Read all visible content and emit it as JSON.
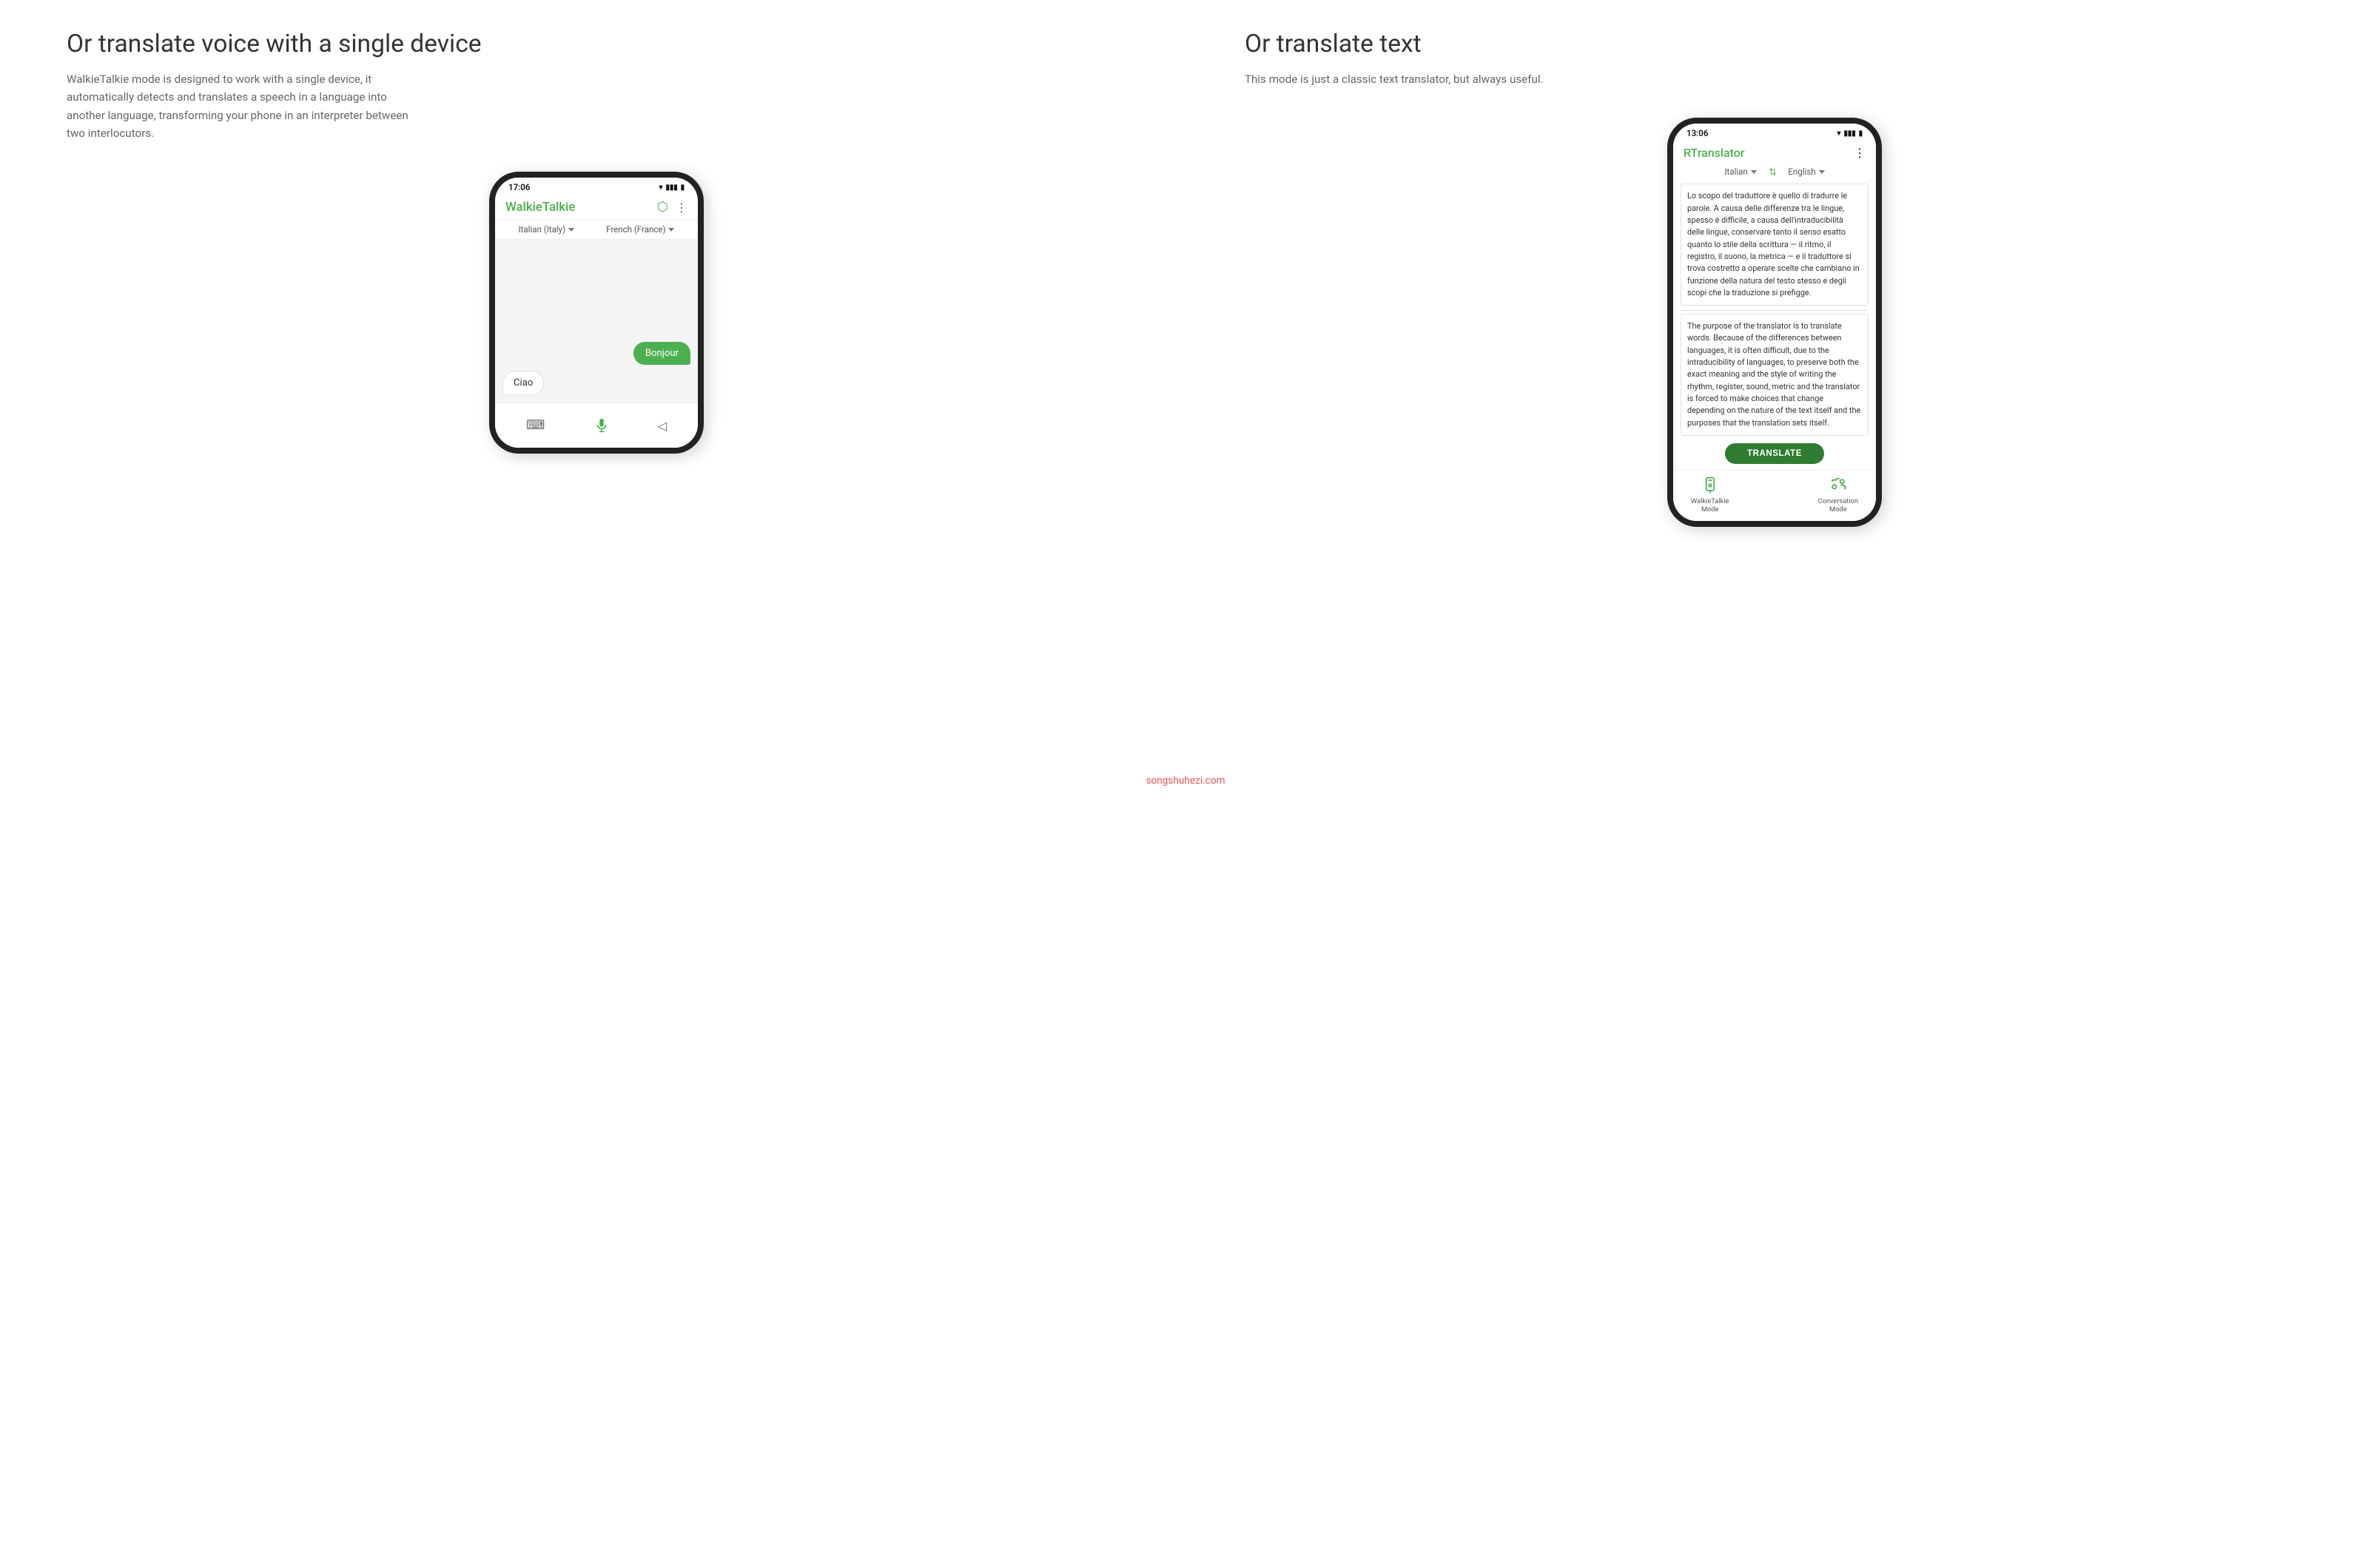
{
  "left": {
    "title": "Or translate voice with a single device",
    "description": "WalkieTalkie mode is designed to work with a single device, it automatically detects and translates a speech in a language into another language, transforming your phone in an interpreter between two interlocutors.",
    "phone": {
      "status_time": "17:06",
      "app_title": "WalkieTalkie",
      "lang_source": "Italian (Italy)",
      "lang_target": "French (France)",
      "bubble_right": "Bonjour",
      "bubble_left": "Ciao"
    }
  },
  "right": {
    "title": "Or translate text",
    "description": "This mode is just a classic text translator, but always useful.",
    "phone": {
      "status_time": "13:06",
      "app_title": "RTranslator",
      "lang_source": "Italian",
      "lang_target": "English",
      "source_text": "Lo scopo del traduttore è quello di tradurre le parole. A causa delle differenze tra le lingue, spesso è difficile, a causa dell'intraducibilità delle lingue, conservare tanto il senso esatto quanto lo stile della scrittura — il ritmo, il registro, il suono, la metrica — e il traduttore si trova costretto a operare scelte che cambiano in funzione della natura del testo stesso e degli scopi che la traduzione si prefigge.",
      "translated_text": "The purpose of the translator is to translate words. Because of the differences between languages, it is often difficult, due to the intraducibility of languages, to preserve both the exact meaning and the style of writing  the rhythm, register, sound, metric  and the translator is forced to make choices that change depending on the nature of the text itself and the purposes that the translation sets itself.",
      "translate_btn": "TRANSLATE",
      "nav_walkie": "WalkieTalkie\nMode",
      "nav_conversation": "Conversation\nMode"
    }
  },
  "watermark": "songshuhezi.com",
  "icons": {
    "mic": "🎤",
    "keyboard": "⌨",
    "speaker": "🔊",
    "more": "⋮",
    "export": "↪"
  }
}
